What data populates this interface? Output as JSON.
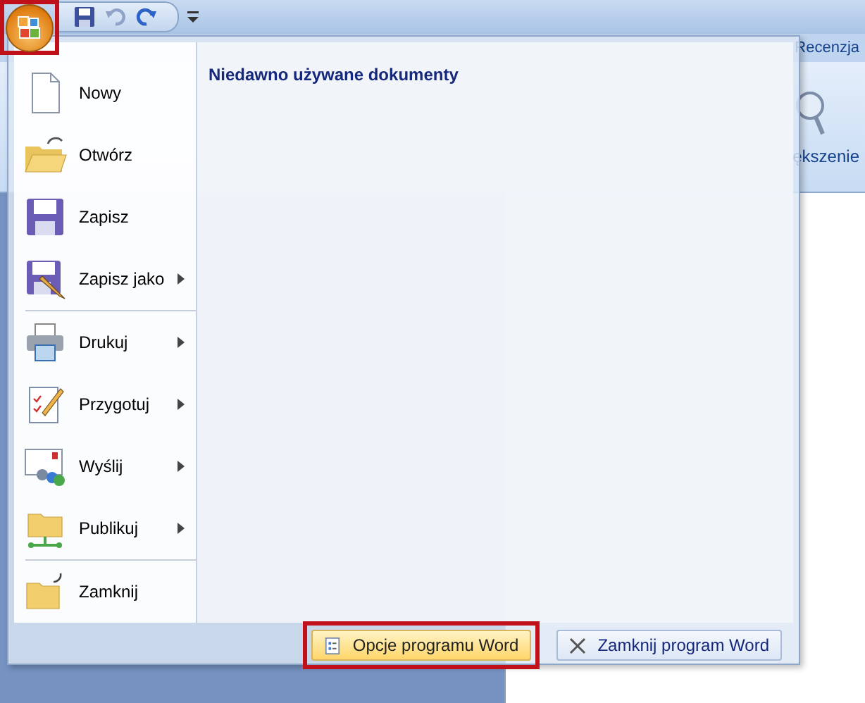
{
  "ribbon": {
    "tabs": [
      "Recenzja"
    ],
    "zoom_button": "ększenie"
  },
  "office_menu": {
    "recent_title": "Niedawno używane dokumenty",
    "groups": [
      [
        {
          "label": "Nowy",
          "submenu": false
        },
        {
          "label": "Otwórz",
          "submenu": false
        },
        {
          "label": "Zapisz",
          "submenu": false
        },
        {
          "label": "Zapisz jako",
          "submenu": true
        }
      ],
      [
        {
          "label": "Drukuj",
          "submenu": true
        },
        {
          "label": "Przygotuj",
          "submenu": true
        },
        {
          "label": "Wyślij",
          "submenu": true
        },
        {
          "label": "Publikuj",
          "submenu": true
        }
      ],
      [
        {
          "label": "Zamknij",
          "submenu": false
        }
      ]
    ],
    "bottom_buttons": [
      {
        "label": "Opcje programu Word",
        "selected": true
      },
      {
        "label": "Zamknij program Word",
        "selected": false
      }
    ]
  }
}
